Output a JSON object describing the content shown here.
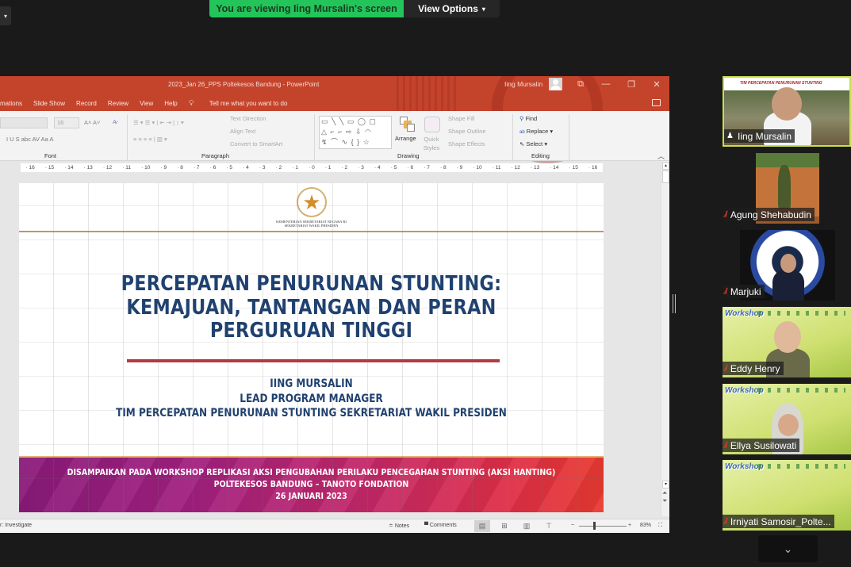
{
  "zoom_meeting": {
    "share_banner": "You are viewing Iing Mursalin's screen",
    "view_options": "View Options",
    "view_options_chevron": "⌄",
    "more_participants_icon": "chevron-down",
    "left_tab_arrow": "▾"
  },
  "powerpoint": {
    "title": "2023_Jan 26_PPS Poltekesos Bandung  -  PowerPoint",
    "user": "Iing Mursalin",
    "window_buttons": [
      "⧉",
      "—",
      "❐",
      "✕"
    ],
    "menu": [
      "mations",
      "Slide Show",
      "Record",
      "Review",
      "View",
      "Help"
    ],
    "tell_me": "Tell me what you want to do",
    "ribbon": {
      "font_size": "16",
      "font_group": "Font",
      "paragraph_group": "Paragraph",
      "drawing_group": "Drawing",
      "editing_group": "Editing",
      "text_direction": "Text Direction",
      "align_text": "Align Text",
      "convert_smartart": "Convert to SmartArt",
      "arrange": "Arrange",
      "quick_styles": "Quick Styles",
      "shape_fill": "Shape Fill",
      "shape_outline": "Shape Outline",
      "shape_effects": "Shape Effects",
      "find": "Find",
      "replace": "Replace",
      "select": "Select",
      "font_buttons": "A˄  A˅",
      "format_buttons": "I   U   S   abc   AV   Aa   A",
      "shapes_row1": "▭ ╲ ╲ ▭ ◯ ▢",
      "shapes_row2": "△ ⌐ ⌐ ⇨ ⇩ ◠",
      "shapes_row3": "↯ ⌒ ∿ { } ☆"
    },
    "ruler": [
      "16",
      "15",
      "14",
      "13",
      "12",
      "11",
      "10",
      "9",
      "8",
      "7",
      "6",
      "5",
      "4",
      "3",
      "2",
      "1",
      "0",
      "1",
      "2",
      "3",
      "4",
      "5",
      "6",
      "7",
      "8",
      "9",
      "10",
      "11",
      "12",
      "13",
      "14",
      "15",
      "16"
    ],
    "status": {
      "left": "r: Investigate",
      "notes": "Notes",
      "comments": "Comments",
      "zoom": "83%"
    }
  },
  "slide": {
    "org_line1": "KEMENTERIAN SEKRETARIAT NEGARA RI",
    "org_line2": "SEKRETARIAT WAKIL PRESIDEN",
    "title_lines": [
      "PERCEPATAN PENURUNAN STUNTING:",
      "KEMAJUAN, TANTANGAN DAN PERAN",
      "PERGURUAN TINGGI"
    ],
    "presenter_lines": [
      "IING MURSALIN",
      "LEAD PROGRAM MANAGER",
      "TIM PERCEPATAN PENURUNAN STUNTING SEKRETARIAT WAKIL PRESIDEN"
    ],
    "banner_lines": [
      "DISAMPAIKAN PADA WORKSHOP REPLIKASI AKSI PENGUBAHAN PERILAKU PENCEGAHAN STUNTING (AKSI HANTING)",
      "POLTEKESOS BANDUNG – TANOTO FONDATION",
      "26 JANUARI 2023"
    ]
  },
  "participants": [
    {
      "name": "Iing Mursalin",
      "muted": false,
      "speaking": true,
      "background": "TIM PERCEPATAN PENURUNAN STUNTING"
    },
    {
      "name": "Agung Shehabudin",
      "muted": true
    },
    {
      "name": "Marjuki",
      "muted": true,
      "background": "POLITEKNIK KESEJAHTERAAN SOSIAL"
    },
    {
      "name": "Eddy Henry",
      "muted": true,
      "background": "Workshop"
    },
    {
      "name": "Ellya Susilowati",
      "muted": true,
      "background": "Workshop"
    },
    {
      "name": "Irniyati Samosir_Polte...",
      "muted": true,
      "background": "Workshop"
    }
  ],
  "colors": {
    "ppt_accent": "#c4432b",
    "zoom_green": "#23c55a",
    "slide_title": "#1f4170",
    "muted_icon": "#e0392b"
  }
}
